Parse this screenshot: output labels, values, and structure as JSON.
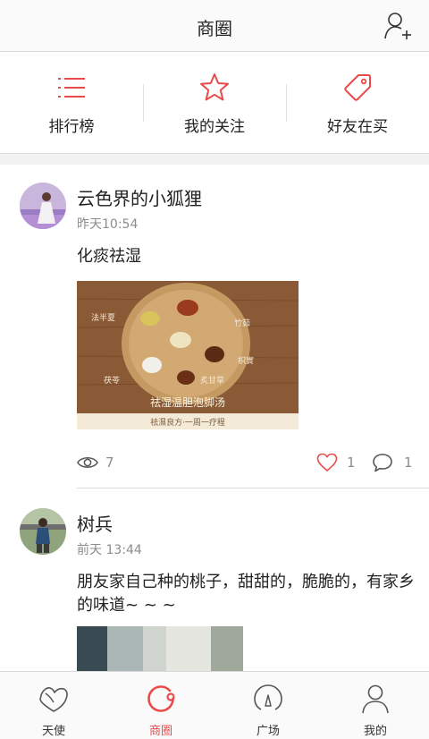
{
  "header": {
    "title": "商圈",
    "add_friend_icon": "add-friend-icon"
  },
  "quick_tabs": [
    {
      "label": "排行榜",
      "icon": "list-icon"
    },
    {
      "label": "我的关注",
      "icon": "star-icon"
    },
    {
      "label": "好友在买",
      "icon": "tag-icon"
    }
  ],
  "accent_color": "#e94b4b",
  "posts": [
    {
      "user": "云色界的小狐狸",
      "time": "昨天10:54",
      "text": "化痰祛湿",
      "image_caption": "祛湿温胆泡脚汤",
      "image_subcaption": "祛濕良方·一周一疗程",
      "herb_labels": [
        "法半夏",
        "竹茹",
        "枳實",
        "茯苓",
        "炙甘草"
      ],
      "views": "7",
      "likes": "1",
      "comments": "1"
    },
    {
      "user": "树兵",
      "time": "前天 13:44",
      "text": "朋友家自己种的桃子，甜甜的，脆脆的，有家乡的味道~ ~ ~"
    }
  ],
  "bottom_nav": [
    {
      "label": "天使",
      "icon": "angel-icon",
      "active": false
    },
    {
      "label": "商圈",
      "icon": "business-circle-icon",
      "active": true
    },
    {
      "label": "广场",
      "icon": "plaza-icon",
      "active": false
    },
    {
      "label": "我的",
      "icon": "profile-icon",
      "active": false
    }
  ]
}
